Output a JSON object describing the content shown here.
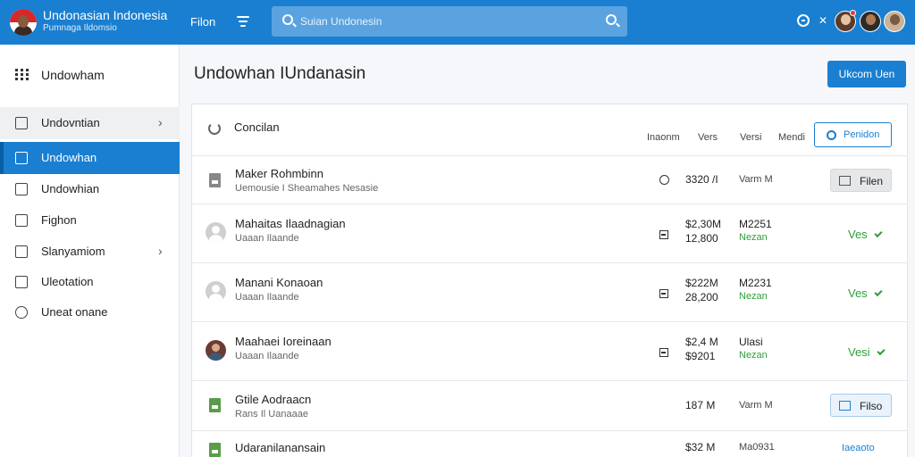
{
  "app": {
    "title": "Undonasian Indonesia",
    "subtitle": "Pumnaga Ildomsio",
    "top_link": "Filon",
    "search_placeholder": "Suian Undonesin"
  },
  "sidebar": {
    "header_label": "Undowham",
    "items": [
      {
        "label": "Undovntian",
        "icon": "home-icon",
        "has_chevron": true,
        "state": "hover"
      },
      {
        "label": "Undowhan",
        "icon": "building-icon",
        "has_chevron": false,
        "state": "active"
      },
      {
        "label": "Undowhian",
        "icon": "calendar-icon",
        "has_chevron": false,
        "state": ""
      },
      {
        "label": "Fighon",
        "icon": "chart-icon",
        "has_chevron": false,
        "state": ""
      },
      {
        "label": "Slanyamiom",
        "icon": "home-outline-icon",
        "has_chevron": true,
        "state": ""
      },
      {
        "label": "Uleotation",
        "icon": "tag-icon",
        "has_chevron": false,
        "state": ""
      },
      {
        "label": "Uneat onane",
        "icon": "circle-icon",
        "has_chevron": false,
        "state": ""
      }
    ]
  },
  "main": {
    "page_title": "Undowhan IUndanasin",
    "primary_button": "Ukcom Uen",
    "panel": {
      "title": "Concilan",
      "columns": [
        "Inaonm",
        "Vers",
        "Versi",
        "Mendi"
      ],
      "action_button": "Penidon"
    },
    "rows": [
      {
        "name": "Maker Rohmbinn",
        "sub": "Uemousie I Sheamahes Nesasie",
        "icon": "document-icon",
        "val1": "3320 /I",
        "val2": "Varm M",
        "action": "Filen",
        "action_type": "button"
      },
      {
        "name": "Mahaitas Ilaadnagian",
        "sub": "Uaaan Ilaande",
        "icon": "avatar-icon",
        "val1": "$2,30M",
        "val1b": "12,800",
        "val2": "M2251",
        "val2b": "Nezan",
        "action": "Ves",
        "action_type": "check"
      },
      {
        "name": "Manani Konaoan",
        "sub": "Uaaan Ilaande",
        "icon": "avatar-icon",
        "val1": "$222M",
        "val1b": "28,200",
        "val2": "M2231",
        "val2b": "Nezan",
        "action": "Ves",
        "action_type": "check"
      },
      {
        "name": "Maahaei Ioreinaan",
        "sub": "Uaaan Ilaande",
        "icon": "avatar-photo-icon",
        "val1": "$2,4 M",
        "val1b": "$9201",
        "val2": "Ulasi",
        "val2b": "Nezan",
        "action": "Vesi",
        "action_type": "check"
      },
      {
        "name": "Gtile Aodraacn",
        "sub": "Rans Il Uanaaae",
        "icon": "document-green-icon",
        "val1": "187 M",
        "val2": "Varm M",
        "action": "Filso",
        "action_type": "button-blue"
      },
      {
        "name": "Udaranilanansain",
        "sub": "",
        "icon": "document-green-icon",
        "val1": "$32 M",
        "val2": "Ma0931",
        "action": "Iaeaoto",
        "action_type": "link"
      }
    ]
  },
  "colors": {
    "brand": "#1a7fd0",
    "positive": "#2e9e3a"
  }
}
